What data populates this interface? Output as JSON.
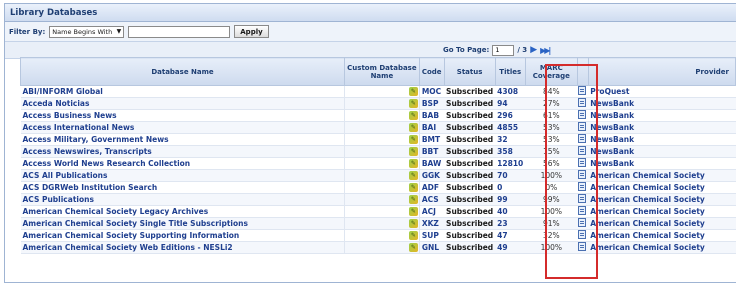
{
  "panel": {
    "title": "Library Databases"
  },
  "filter": {
    "label": "Filter By:",
    "selected": "Name Begins With",
    "input_value": "",
    "apply_label": "Apply"
  },
  "pager": {
    "label": "Go To Page:",
    "page": "1",
    "total": "/ 3"
  },
  "columns": {
    "name": "Database Name",
    "custom": "Custom Database Name",
    "code": "Code",
    "status": "Status",
    "titles": "Titles",
    "coverage": "MARC Coverage",
    "provider": "Provider"
  },
  "highlight_color": "#d42b2b",
  "rows": [
    {
      "name": "ABI/INFORM Global",
      "code": "MOC",
      "status": "Subscribed",
      "titles": "4308",
      "coverage": "84%",
      "provider": "ProQuest"
    },
    {
      "name": "Acceda Noticias",
      "code": "BSP",
      "status": "Subscribed",
      "titles": "94",
      "coverage": "27%",
      "provider": "NewsBank"
    },
    {
      "name": "Access Business News",
      "code": "BAB",
      "status": "Subscribed",
      "titles": "296",
      "coverage": "61%",
      "provider": "NewsBank"
    },
    {
      "name": "Access International News",
      "code": "BAI",
      "status": "Subscribed",
      "titles": "4855",
      "coverage": "53%",
      "provider": "NewsBank"
    },
    {
      "name": "Access Military, Government News",
      "code": "BMT",
      "status": "Subscribed",
      "titles": "32",
      "coverage": "53%",
      "provider": "NewsBank"
    },
    {
      "name": "Access Newswires, Transcripts",
      "code": "BBT",
      "status": "Subscribed",
      "titles": "358",
      "coverage": "15%",
      "provider": "NewsBank"
    },
    {
      "name": "Access World News Research Collection",
      "code": "BAW",
      "status": "Subscribed",
      "titles": "12810",
      "coverage": "56%",
      "provider": "NewsBank"
    },
    {
      "name": "ACS All Publications",
      "code": "GGK",
      "status": "Subscribed",
      "titles": "70",
      "coverage": "100%",
      "provider": "American Chemical Society"
    },
    {
      "name": "ACS DGRWeb Institution Search",
      "code": "ADF",
      "status": "Subscribed",
      "titles": "0",
      "coverage": "0%",
      "provider": "American Chemical Society"
    },
    {
      "name": "ACS Publications",
      "code": "ACS",
      "status": "Subscribed",
      "titles": "99",
      "coverage": "99%",
      "provider": "American Chemical Society"
    },
    {
      "name": "American Chemical Society Legacy Archives",
      "code": "ACJ",
      "status": "Subscribed",
      "titles": "40",
      "coverage": "100%",
      "provider": "American Chemical Society"
    },
    {
      "name": "American Chemical Society Single Title Subscriptions",
      "code": "XKZ",
      "status": "Subscribed",
      "titles": "23",
      "coverage": "91%",
      "provider": "American Chemical Society"
    },
    {
      "name": "American Chemical Society Supporting Information",
      "code": "SUP",
      "status": "Subscribed",
      "titles": "47",
      "coverage": "32%",
      "provider": "American Chemical Society"
    },
    {
      "name": "American Chemical Society Web Editions - NESLi2",
      "code": "GNL",
      "status": "Subscribed",
      "titles": "49",
      "coverage": "100%",
      "provider": "American Chemical Society"
    }
  ]
}
